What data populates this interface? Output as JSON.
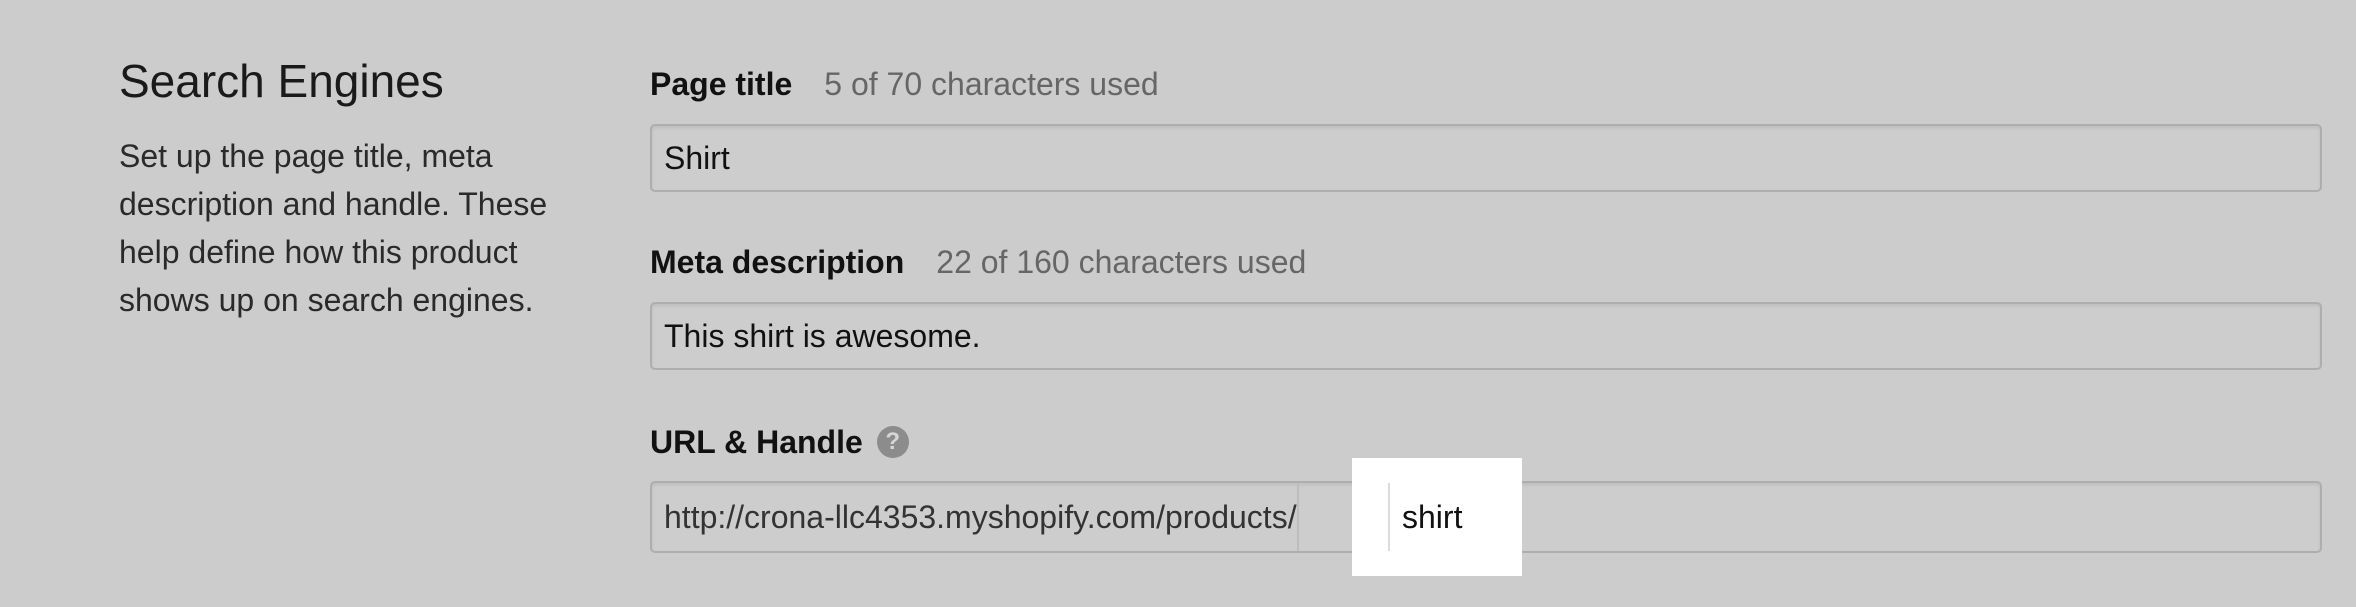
{
  "section": {
    "heading": "Search Engines",
    "description": "Set up the page title, meta description and handle. These help define how this product shows up on search engines."
  },
  "page_title": {
    "label": "Page title",
    "count_text": "5 of 70 characters used",
    "value": "Shirt"
  },
  "meta_description": {
    "label": "Meta description",
    "count_text": "22 of 160 characters used",
    "value": "This shirt is awesome."
  },
  "url_handle": {
    "label": "URL & Handle",
    "help_icon": "question-circle-icon",
    "help_glyph": "?",
    "prefix": "http://crona-llc4353.myshopify.com/products/",
    "handle": "shirt"
  }
}
